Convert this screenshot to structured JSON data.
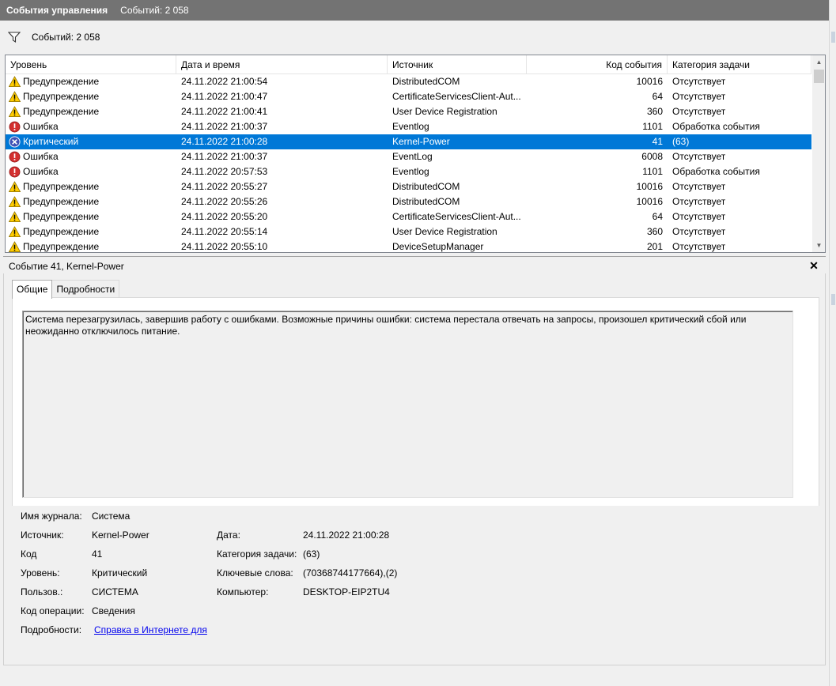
{
  "title_bar": {
    "title": "События управления",
    "count": "Событий: 2 058"
  },
  "filter_bar": {
    "icon": "filter-icon",
    "count": "Событий: 2 058"
  },
  "grid": {
    "columns": [
      "Уровень",
      "Дата и время",
      "Источник",
      "Код события",
      "Категория задачи"
    ],
    "rows": [
      {
        "level": "Предупреждение",
        "icon": "warning-icon",
        "datetime": "24.11.2022 21:00:54",
        "source": "DistributedCOM",
        "event_id": "10016",
        "category": "Отсутствует"
      },
      {
        "level": "Предупреждение",
        "icon": "warning-icon",
        "datetime": "24.11.2022 21:00:47",
        "source": "CertificateServicesClient-Aut...",
        "event_id": "64",
        "category": "Отсутствует"
      },
      {
        "level": "Предупреждение",
        "icon": "warning-icon",
        "datetime": "24.11.2022 21:00:41",
        "source": "User Device Registration",
        "event_id": "360",
        "category": "Отсутствует"
      },
      {
        "level": "Ошибка",
        "icon": "error-icon",
        "datetime": "24.11.2022 21:00:37",
        "source": "Eventlog",
        "event_id": "1101",
        "category": "Обработка события"
      },
      {
        "level": "Критический",
        "icon": "critical-icon",
        "datetime": "24.11.2022 21:00:28",
        "source": "Kernel-Power",
        "event_id": "41",
        "category": "(63)",
        "selected": true
      },
      {
        "level": "Ошибка",
        "icon": "error-icon",
        "datetime": "24.11.2022 21:00:37",
        "source": "EventLog",
        "event_id": "6008",
        "category": "Отсутствует"
      },
      {
        "level": "Ошибка",
        "icon": "error-icon",
        "datetime": "24.11.2022 20:57:53",
        "source": "Eventlog",
        "event_id": "1101",
        "category": "Обработка события"
      },
      {
        "level": "Предупреждение",
        "icon": "warning-icon",
        "datetime": "24.11.2022 20:55:27",
        "source": "DistributedCOM",
        "event_id": "10016",
        "category": "Отсутствует"
      },
      {
        "level": "Предупреждение",
        "icon": "warning-icon",
        "datetime": "24.11.2022 20:55:26",
        "source": "DistributedCOM",
        "event_id": "10016",
        "category": "Отсутствует"
      },
      {
        "level": "Предупреждение",
        "icon": "warning-icon",
        "datetime": "24.11.2022 20:55:20",
        "source": "CertificateServicesClient-Aut...",
        "event_id": "64",
        "category": "Отсутствует"
      },
      {
        "level": "Предупреждение",
        "icon": "warning-icon",
        "datetime": "24.11.2022 20:55:14",
        "source": "User Device Registration",
        "event_id": "360",
        "category": "Отсутствует"
      },
      {
        "level": "Предупреждение",
        "icon": "warning-icon",
        "datetime": "24.11.2022 20:55:10",
        "source": "DeviceSetupManager",
        "event_id": "201",
        "category": "Отсутствует"
      }
    ]
  },
  "detail": {
    "header": "Событие 41, Kernel-Power",
    "tabs": [
      "Общие",
      "Подробности"
    ],
    "message": "Система перезагрузилась, завершив работу с ошибками. Возможные причины ошибки: система перестала отвечать на запросы, произошел критический сбой или неожиданно отключилось питание.",
    "labels": {
      "log_name": "Имя журнала:",
      "source": "Источник:",
      "code": "Код",
      "level": "Уровень:",
      "user": "Пользов.:",
      "opcode": "Код операции:",
      "more_info": "Подробности:",
      "date": "Дата:",
      "task_category": "Категория задачи:",
      "keywords": "Ключевые слова:",
      "computer": "Компьютер:"
    },
    "values": {
      "log_name": "Система",
      "source": "Kernel-Power",
      "code": "41",
      "level": "Критический",
      "user": "СИСТЕМА",
      "opcode": "Сведения",
      "more_info_link": "Справка в Интернете для ",
      "date": "24.11.2022 21:00:28",
      "task_category": "(63)",
      "keywords": "(70368744177664),(2)",
      "computer": "DESKTOP-EIP2TU4"
    }
  },
  "colors": {
    "selection": "#0078d7",
    "titlebar": "#737373",
    "warning": "#ffcc00",
    "error": "#d32f2f",
    "critical": "#3f51b5"
  }
}
